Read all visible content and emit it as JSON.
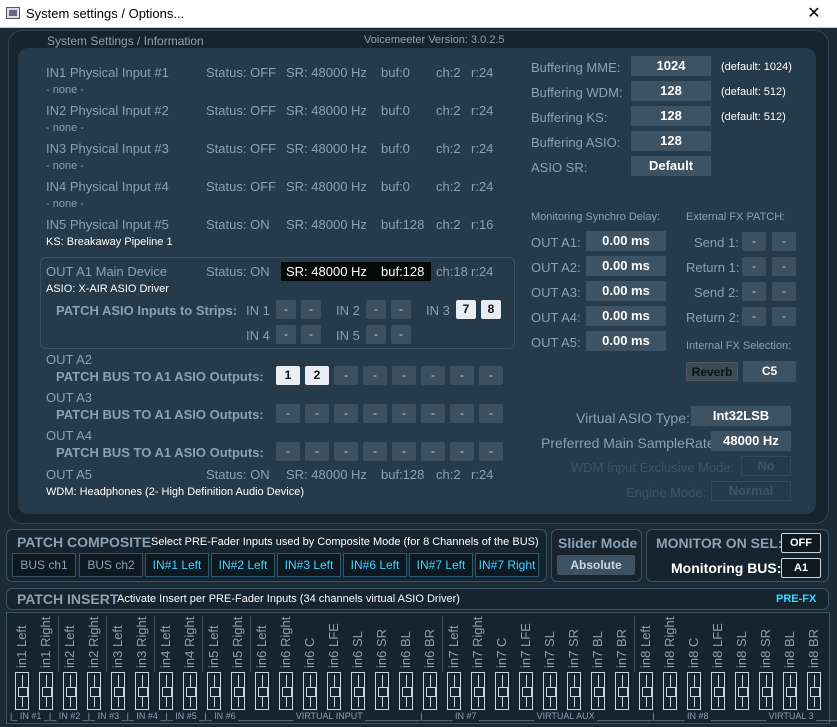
{
  "window": {
    "title": "System settings / Options...",
    "close_glyph": "✕"
  },
  "header": {
    "left": "System Settings / Information",
    "version": "Voicemeeter Version: 3.0.2.5"
  },
  "inputs": [
    {
      "name": "IN1 Physical Input #1",
      "status": "Status: OFF",
      "sr": "SR: 48000 Hz",
      "buf": "buf:0",
      "ch": "ch:2",
      "r": "r:24",
      "device": "- none -"
    },
    {
      "name": "IN2 Physical Input #2",
      "status": "Status: OFF",
      "sr": "SR: 48000 Hz",
      "buf": "buf:0",
      "ch": "ch:2",
      "r": "r:24",
      "device": "- none -"
    },
    {
      "name": "IN3 Physical Input #3",
      "status": "Status: OFF",
      "sr": "SR: 48000 Hz",
      "buf": "buf:0",
      "ch": "ch:2",
      "r": "r:24",
      "device": "- none -"
    },
    {
      "name": "IN4 Physical Input #4",
      "status": "Status: OFF",
      "sr": "SR: 48000 Hz",
      "buf": "buf:0",
      "ch": "ch:2",
      "r": "r:24",
      "device": "- none -"
    },
    {
      "name": "IN5 Physical Input #5",
      "status": "Status: ON",
      "sr": "SR: 48000 Hz",
      "buf": "buf:128",
      "ch": "ch:2",
      "r": "r:16",
      "device": "KS: Breakaway Pipeline 1"
    }
  ],
  "outA1": {
    "name": "OUT A1 Main Device",
    "status": "Status: ON",
    "sr": "SR: 48000 Hz",
    "buf": "buf:128",
    "ch": "ch:18",
    "r": "r:24",
    "device": "ASIO: X-AIR ASIO Driver",
    "patch_label": "PATCH ASIO Inputs to Strips:",
    "in1": "IN 1",
    "in2": "IN 2",
    "in3": "IN 3",
    "in4": "IN 4",
    "in5": "IN 5",
    "dash": "-",
    "in3a": "7",
    "in3b": "8"
  },
  "outA2": {
    "name": "OUT A2",
    "patch": "PATCH BUS TO A1 ASIO Outputs:",
    "b1": "1",
    "b2": "2",
    "dash": "-"
  },
  "outA3": {
    "name": "OUT A3",
    "patch": "PATCH BUS TO A1 ASIO Outputs:"
  },
  "outA4": {
    "name": "OUT A4",
    "patch": "PATCH BUS TO A1 ASIO Outputs:"
  },
  "outA5": {
    "name": "OUT A5",
    "status": "Status: ON",
    "sr": "SR: 48000 Hz",
    "buf": "buf:128",
    "ch": "ch:2",
    "r": "r:24",
    "device": "WDM: Headphones (2- High Definition Audio Device)"
  },
  "buffering": [
    {
      "label": "Buffering MME:",
      "value": "1024",
      "default": "(default: 1024)"
    },
    {
      "label": "Buffering WDM:",
      "value": "128",
      "default": "(default: 512)"
    },
    {
      "label": "Buffering KS:",
      "value": "128",
      "default": "(default: 512)"
    },
    {
      "label": "Buffering ASIO:",
      "value": "128",
      "default": ""
    },
    {
      "label": "ASIO SR:",
      "value": "Default",
      "default": ""
    }
  ],
  "monitoring": {
    "title": "Monitoring Synchro Delay:",
    "rows": [
      {
        "label": "OUT A1:",
        "value": "0.00 ms"
      },
      {
        "label": "OUT A2:",
        "value": "0.00 ms"
      },
      {
        "label": "OUT A3:",
        "value": "0.00 ms"
      },
      {
        "label": "OUT A4:",
        "value": "0.00 ms"
      },
      {
        "label": "OUT A5:",
        "value": "0.00 ms"
      }
    ]
  },
  "extfx": {
    "title": "External FX PATCH:",
    "rows": [
      "Send 1:",
      "Return 1:",
      "Send 2:",
      "Return 2:"
    ],
    "dash": "-"
  },
  "intfx": {
    "title": "Internal FX Selection:",
    "reverb": "Reverb",
    "c5": "C5"
  },
  "asio": {
    "type_label": "Virtual ASIO Type:",
    "type_value": "Int32LSB",
    "sr_label": "Preferred Main SampleRate:",
    "sr_value": "48000 Hz",
    "wdm_label": "WDM Input Exclusive Mode:",
    "wdm_value": "No",
    "engine_label": "Engine Mode:",
    "engine_value": "Normal"
  },
  "composite": {
    "title": "PATCH COMPOSITE",
    "desc": "Select PRE-Fader Inputs used by Composite Mode (for 8 Channels of the BUS)",
    "buttons": [
      "BUS ch1",
      "BUS ch2",
      "IN#1 Left",
      "IN#2 Left",
      "IN#3 Left",
      "IN#6 Left",
      "IN#7 Left",
      "IN#7 Right"
    ]
  },
  "slider": {
    "title": "Slider Mode",
    "value": "Absolute"
  },
  "monitor": {
    "title": "MONITOR ON SEL:",
    "value": "OFF",
    "bus_label": "Monitoring BUS:",
    "bus_value": "A1"
  },
  "insert": {
    "title": "PATCH INSERT",
    "desc": "Activate Insert per PRE-Fader Inputs (34 channels virtual ASIO Driver)",
    "prefx": "PRE-FX",
    "channels": [
      "in1 Left",
      "in1 Right",
      "in2 Left",
      "in2 Right",
      "in3 Left",
      "in3 Right",
      "in4 Left",
      "in4 Right",
      "in5 Left",
      "in5 Right",
      "in6 Left",
      "in6 Right",
      "in6 C",
      "in6 LFE",
      "in6 SL",
      "in6 SR",
      "in6 BL",
      "in6 BR",
      "in7 Left",
      "in7 Right",
      "in7 C",
      "in7 LFE",
      "in7 SL",
      "in7 SR",
      "in7 BL",
      "in7 BR",
      "in8 Left",
      "in8 Right",
      "in8 C",
      "in8 LFE",
      "in8 SL",
      "in8 SR",
      "in8 BL",
      "in8 BR"
    ],
    "footer": "|_ IN #1 _|_ IN #2 _|_ IN #3 _|_ IN #4 _|_ IN #5 _|_ IN #6 ___________ VIRTUAL INPUT ___________|______ IN #7 ___________ VIRTUAL AUX ___________|______ IN #8 ___________ VIRTUAL 3 ___________|"
  }
}
